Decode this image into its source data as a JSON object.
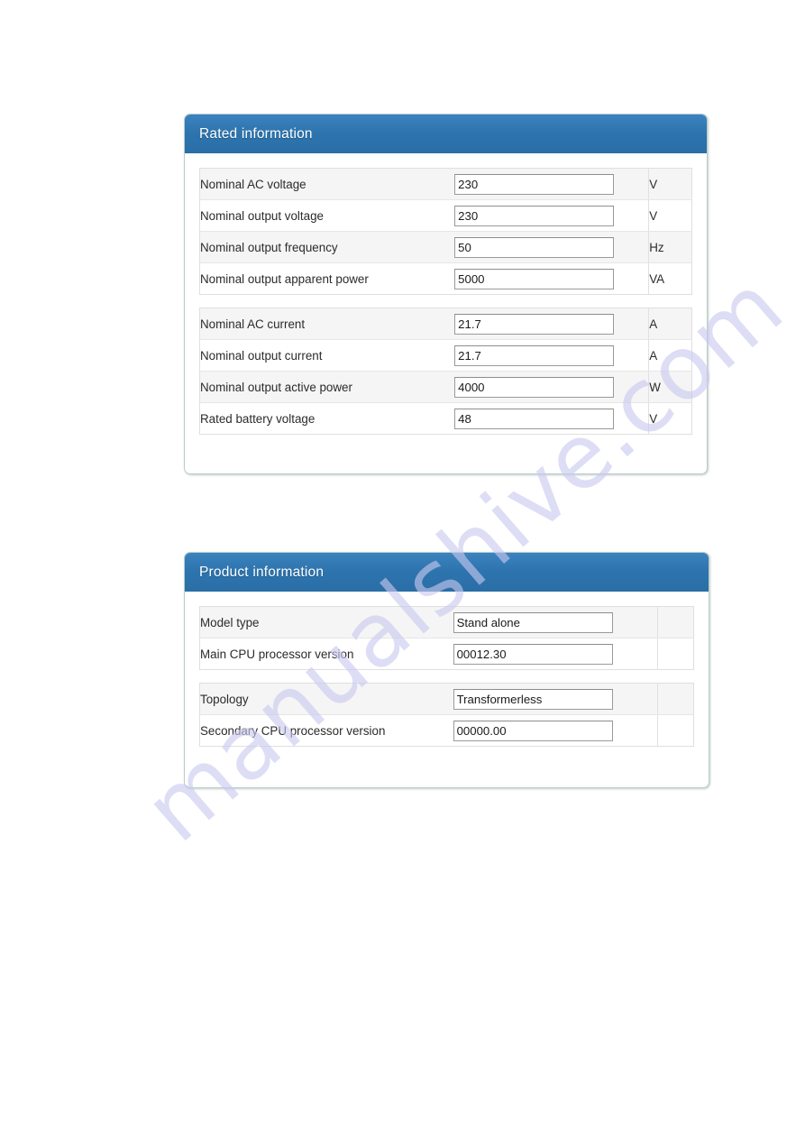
{
  "watermark": {
    "text": "manualshive.com"
  },
  "panels": [
    {
      "id": "rated-information",
      "title": "Rated information",
      "groups": [
        {
          "rows": [
            {
              "label": "Nominal AC voltage",
              "value": "230",
              "unit": "V"
            },
            {
              "label": "Nominal output voltage",
              "value": "230",
              "unit": "V"
            },
            {
              "label": "Nominal output frequency",
              "value": "50",
              "unit": "Hz"
            },
            {
              "label": "Nominal output apparent power",
              "value": "5000",
              "unit": "VA"
            }
          ]
        },
        {
          "rows": [
            {
              "label": "Nominal AC current",
              "value": "21.7",
              "unit": "A"
            },
            {
              "label": "Nominal output current",
              "value": "21.7",
              "unit": "A"
            },
            {
              "label": "Nominal output active power",
              "value": "4000",
              "unit": "W"
            },
            {
              "label": "Rated battery voltage",
              "value": "48",
              "unit": "V"
            }
          ]
        }
      ]
    },
    {
      "id": "product-information",
      "title": "Product information",
      "groups": [
        {
          "rows": [
            {
              "label": "Model type",
              "value": "Stand alone",
              "unit": ""
            },
            {
              "label": "Main CPU processor version",
              "value": "00012.30",
              "unit": ""
            }
          ]
        },
        {
          "rows": [
            {
              "label": "Topology",
              "value": "Transformerless",
              "unit": ""
            },
            {
              "label": "Secondary CPU processor version",
              "value": "00000.00",
              "unit": ""
            }
          ]
        }
      ]
    }
  ],
  "colors": {
    "header_blue": "#2d74ae",
    "panel_border": "#b9cdcb",
    "row_alt": "#f5f5f5",
    "watermark": "#c9c9ef"
  }
}
